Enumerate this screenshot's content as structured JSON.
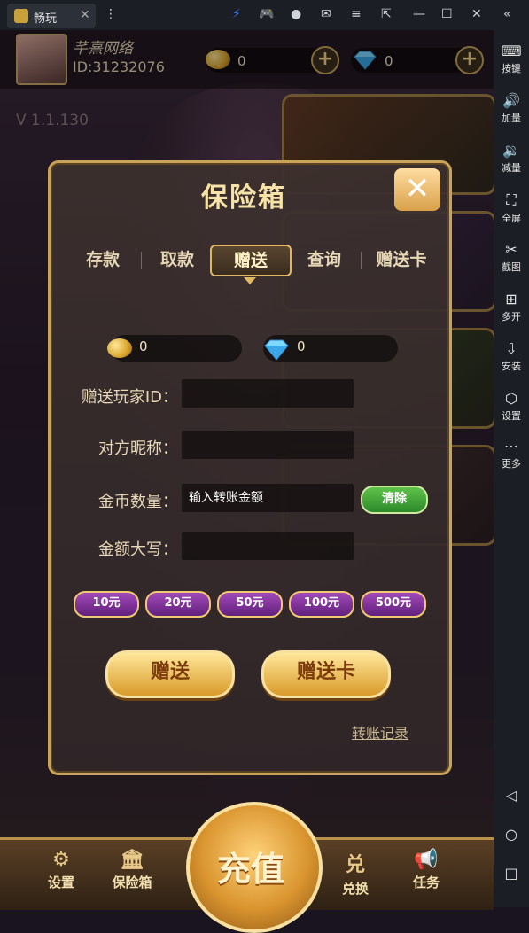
{
  "window": {
    "tab_title": "畅玩",
    "close": "✕",
    "icons": [
      "lightning-icon",
      "gamepad-icon",
      "user-icon",
      "mail-icon",
      "menu-icon",
      "popout-icon",
      "minimize-icon",
      "maximize-icon",
      "close-icon",
      "collapse-icon"
    ]
  },
  "sidebar": {
    "items": [
      {
        "label": "按键",
        "icon": "keyboard-icon",
        "glyph": "⌨"
      },
      {
        "label": "加量",
        "icon": "volume-up-icon",
        "glyph": "🔊"
      },
      {
        "label": "减量",
        "icon": "volume-down-icon",
        "glyph": "🔉"
      },
      {
        "label": "全屏",
        "icon": "fullscreen-icon",
        "glyph": "⛶"
      },
      {
        "label": "截图",
        "icon": "scissors-icon",
        "glyph": "✂"
      },
      {
        "label": "多开",
        "icon": "multi-instance-icon",
        "glyph": "⊞"
      },
      {
        "label": "安装",
        "icon": "apk-install-icon",
        "glyph": "⇩"
      },
      {
        "label": "设置",
        "icon": "settings-icon",
        "glyph": "⬡"
      },
      {
        "label": "更多",
        "icon": "more-icon",
        "glyph": "⋯"
      }
    ],
    "nav": [
      {
        "icon": "back-icon",
        "glyph": "◁"
      },
      {
        "icon": "home-icon",
        "glyph": "○"
      },
      {
        "icon": "recent-apps-icon",
        "glyph": "□"
      }
    ]
  },
  "header": {
    "player_name": "芊熹网络",
    "player_id": "ID:31232076",
    "gold": "0",
    "diamond": "0",
    "version": "V 1.1.130"
  },
  "dialog": {
    "title": "保险箱",
    "close_label": "✕",
    "tabs": [
      "存款",
      "取款",
      "赠送",
      "查询",
      "赠送卡"
    ],
    "active_tab": "赠送",
    "gold_balance": "0",
    "diamond_balance": "0",
    "form": {
      "player_id_label": "赠送玩家ID：",
      "nickname_label": "对方昵称：",
      "amount_label": "金币数量：",
      "amount_placeholder": "输入转账金额",
      "uppercase_label": "金额大写：",
      "clear_label": "清除"
    },
    "amount_buttons": [
      "10元",
      "20元",
      "50元",
      "100元",
      "500元"
    ],
    "gift_button": "赠送",
    "gift_card_button": "赠送卡",
    "transfer_record": "转账记录"
  },
  "bottom_bar": {
    "settings": "设置",
    "safe": "保险箱",
    "recharge": "充值",
    "redeem": "兑换",
    "redeem_icon_text": "兑",
    "tasks": "任务"
  },
  "colors": {
    "gold_accent": "#c9a35a",
    "dialog_bg": "#3c302e",
    "green_button": "#3fa63a",
    "purple_button": "#8a3aa8"
  }
}
